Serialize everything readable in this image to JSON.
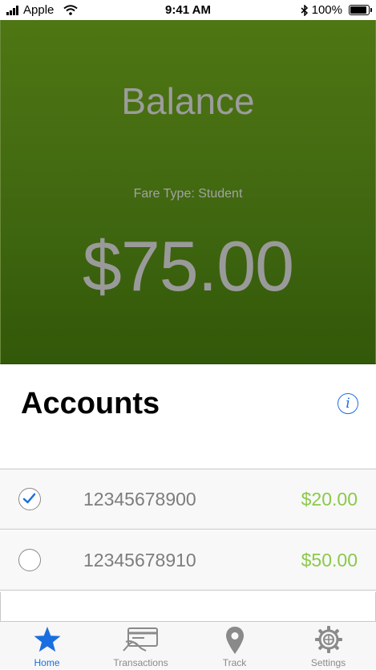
{
  "status_bar": {
    "carrier": "Apple",
    "time": "9:41 AM",
    "battery": "100%",
    "battery_level": 1.0
  },
  "balance": {
    "title": "Balance",
    "fare_type": "Fare Type: Student",
    "amount": "$75.00"
  },
  "accounts": {
    "title": "Accounts",
    "info_icon": "info-icon",
    "rows": [
      {
        "number": "12345678900",
        "amount": "$20.00",
        "selected": true
      },
      {
        "number": "12345678910",
        "amount": "$50.00",
        "selected": false
      }
    ]
  },
  "tab_bar": {
    "tabs": [
      {
        "label": "Home",
        "icon": "star-icon",
        "active": true
      },
      {
        "label": "Transactions",
        "icon": "card-icon",
        "active": false
      },
      {
        "label": "Track",
        "icon": "location-pin-icon",
        "active": false
      },
      {
        "label": "Settings",
        "icon": "gear-icon",
        "active": false
      }
    ]
  },
  "colors": {
    "accent": "#1a6fe0",
    "amount_green": "#8bc94a",
    "panel_green": "#426911"
  }
}
